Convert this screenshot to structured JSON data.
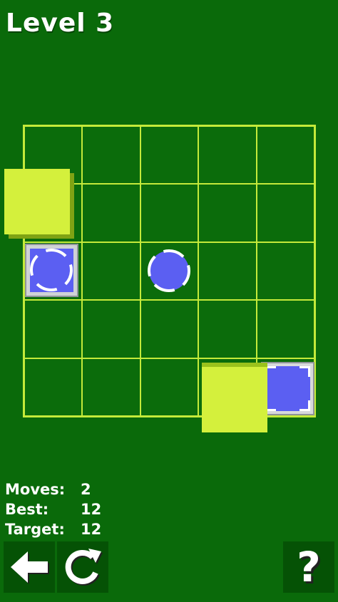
{
  "header": {
    "level_title": "Level 3"
  },
  "board": {
    "rows": 5,
    "cols": 5
  },
  "colors": {
    "background": "#0a6a0a",
    "grid_line": "#c4ea3a",
    "block": "#d4f03c",
    "ball": "#5b5ff2",
    "target_frame": "#cfd2d6"
  },
  "stats": {
    "moves_label": "Moves:",
    "moves_value": "2",
    "best_label": "Best:",
    "best_value": "12",
    "target_label": "Target:",
    "target_value": "12"
  },
  "controls": {
    "back_icon": "left-arrow-icon",
    "restart_icon": "restart-icon",
    "help_label": "?"
  }
}
